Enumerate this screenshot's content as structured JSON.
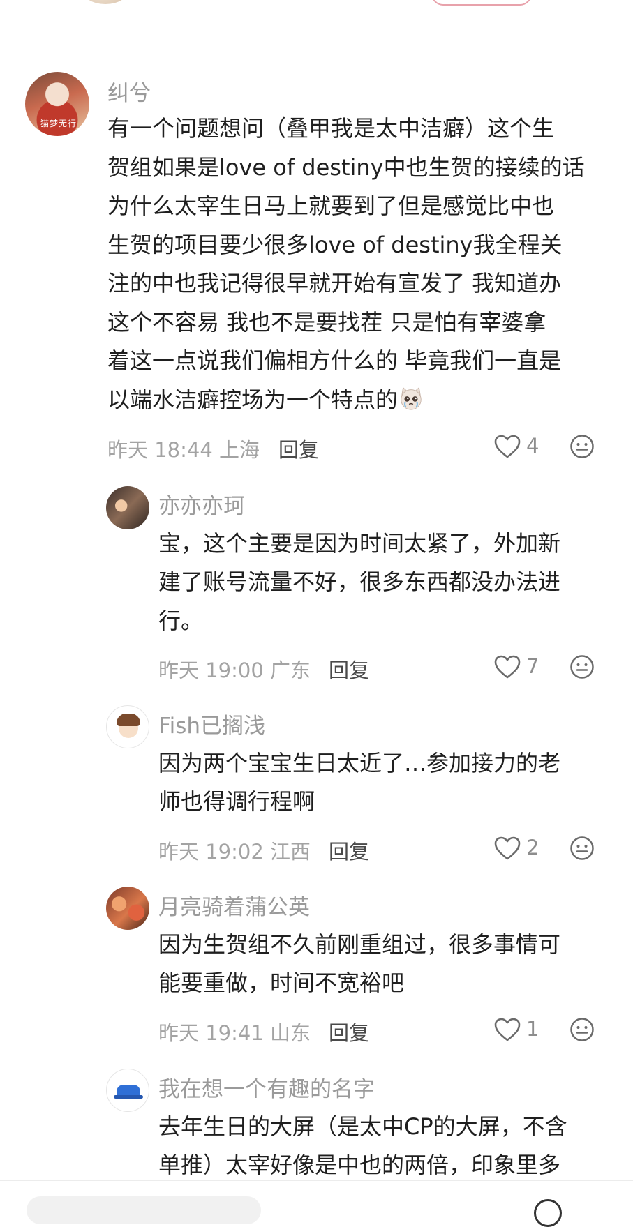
{
  "comments": [
    {
      "user": "纠兮",
      "avatar_text": "猫梦无行",
      "lines": [
        "有一个问题想问（叠甲我是太中洁癖）这个生",
        "贺组如果是love of destiny中也生贺的接续的话",
        "为什么太宰生日马上就要到了但是感觉比中也",
        "生贺的项目要少很多love of destiny我全程关",
        "注的中也我记得很早就开始有宣发了 我知道办",
        "这个不容易 我也不是要找茬 只是怕有宰婆拿",
        "着这一点说我们偏相方什么的 毕竟我们一直是",
        "以端水洁癖控场为一个特点的"
      ],
      "emoji": "crying-cat-emoji",
      "time": "昨天 18:44 上海",
      "reply_label": "回复",
      "likes": "4"
    }
  ],
  "replies": [
    {
      "user": "亦亦亦珂",
      "lines": [
        "宝，这个主要是因为时间太紧了，外加新",
        "建了账号流量不好，很多东西都没办法进",
        "行。"
      ],
      "time": "昨天 19:00 广东",
      "reply_label": "回复",
      "likes": "7"
    },
    {
      "user": "Fish已搁浅",
      "lines": [
        "因为两个宝宝生日太近了…参加接力的老",
        "师也得调行程啊"
      ],
      "time": "昨天 19:02 江西",
      "reply_label": "回复",
      "likes": "2"
    },
    {
      "user": "月亮骑着蒲公英",
      "lines": [
        "因为生贺组不久前刚重组过，很多事情可",
        "能要重做，时间不宽裕吧"
      ],
      "time": "昨天 19:41 山东",
      "reply_label": "回复",
      "likes": "1"
    },
    {
      "user": "我在想一个有趣的名字",
      "lines": [
        "去年生日的大屏（是太中CP的大屏，不含",
        "单推）太宰好像是中也的两倍，印象里多"
      ]
    }
  ],
  "icons": {
    "like": "heart-outline-icon",
    "emoji_react": "smiley-face-icon"
  },
  "colors": {
    "name": "#9a9a9a",
    "body": "#1f1f1f",
    "meta": "#a3a3a3",
    "follow_border": "#e8a2ab"
  }
}
